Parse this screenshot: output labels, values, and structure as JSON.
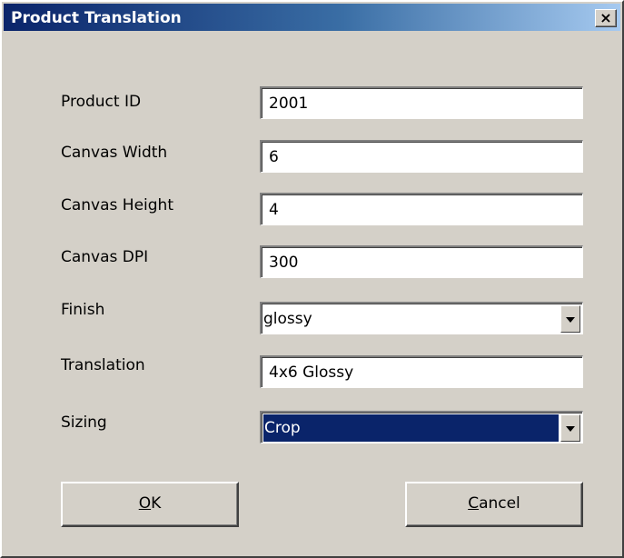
{
  "window": {
    "title": "Product Translation",
    "close_label": "×"
  },
  "form": {
    "product_id": {
      "label": "Product ID",
      "value": "2001"
    },
    "canvas_width": {
      "label": "Canvas Width",
      "value": "6"
    },
    "canvas_height": {
      "label": "Canvas Height",
      "value": "4"
    },
    "canvas_dpi": {
      "label": "Canvas DPI",
      "value": "300"
    },
    "finish": {
      "label": "Finish",
      "value": "glossy"
    },
    "translation": {
      "label": "Translation",
      "value": "4x6 Glossy"
    },
    "sizing": {
      "label": "Sizing",
      "value": "Crop"
    }
  },
  "buttons": {
    "ok": {
      "mnemonic": "O",
      "rest": "K"
    },
    "cancel": {
      "mnemonic": "C",
      "rest": "ancel"
    }
  }
}
